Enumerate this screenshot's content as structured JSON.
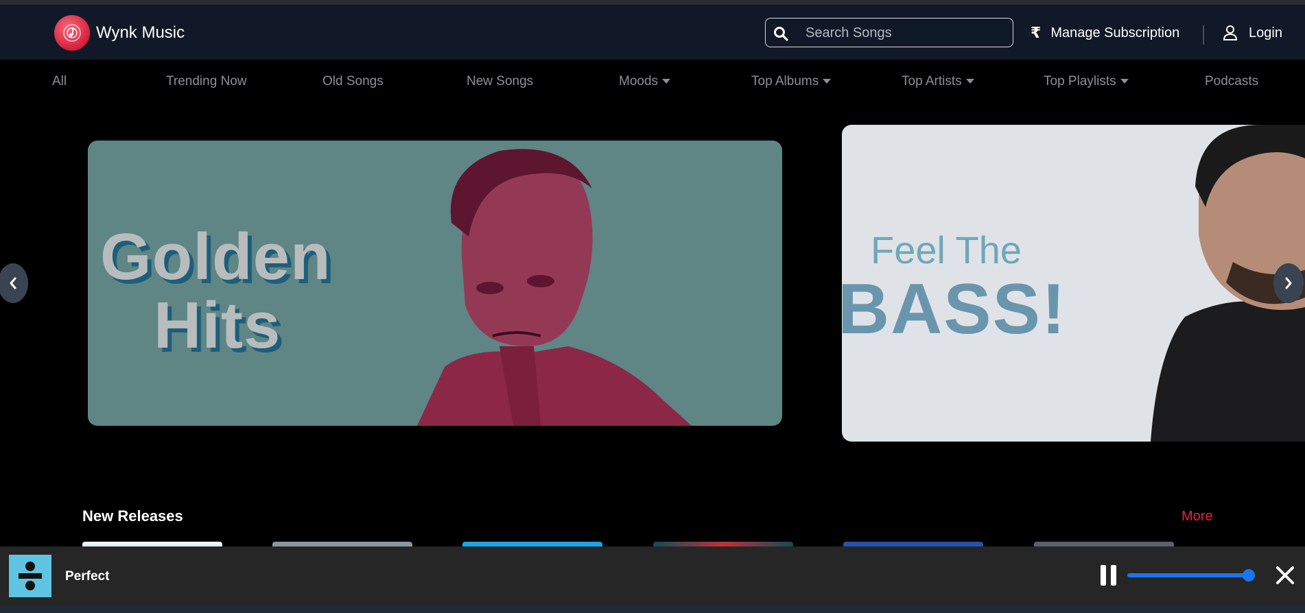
{
  "header": {
    "brand": "Wynk Music",
    "search_placeholder": "Search Songs",
    "manage_symbol": "₹",
    "manage_label": "Manage Subscription",
    "login_label": "Login"
  },
  "nav": {
    "items": [
      "All",
      "Trending Now",
      "Old Songs",
      "New Songs",
      "Moods",
      "Top Albums",
      "Top Artists",
      "Top Playlists",
      "Podcasts"
    ]
  },
  "carousel": {
    "banners": [
      {
        "line1": "Golden",
        "line2": "Hits"
      },
      {
        "line1": "Feel The",
        "line2": "BASS!"
      }
    ]
  },
  "section": {
    "title": "New Releases",
    "more_label": "More"
  },
  "player": {
    "song_title": "Perfect",
    "volume": 0.93
  },
  "colors": {
    "header_bg": "#111827",
    "accent_red": "#e5253a",
    "progress_blue": "#1976f0"
  }
}
